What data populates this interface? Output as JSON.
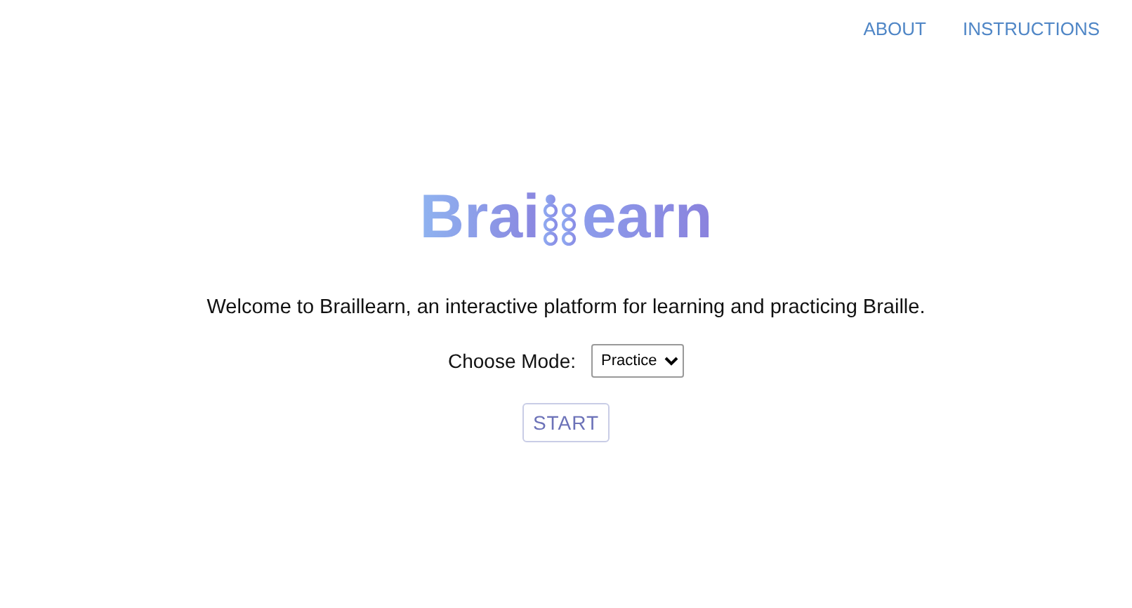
{
  "nav": [
    {
      "label": "ABOUT"
    },
    {
      "label": "INSTRUCTIONS"
    }
  ],
  "logo": {
    "before": "Brai",
    "after": "earn"
  },
  "welcome": "Welcome to Braillearn, an interactive platform for learning and practicing Braille.",
  "mode": {
    "label": "Choose Mode:",
    "value": "Practice"
  },
  "start_button": "START"
}
